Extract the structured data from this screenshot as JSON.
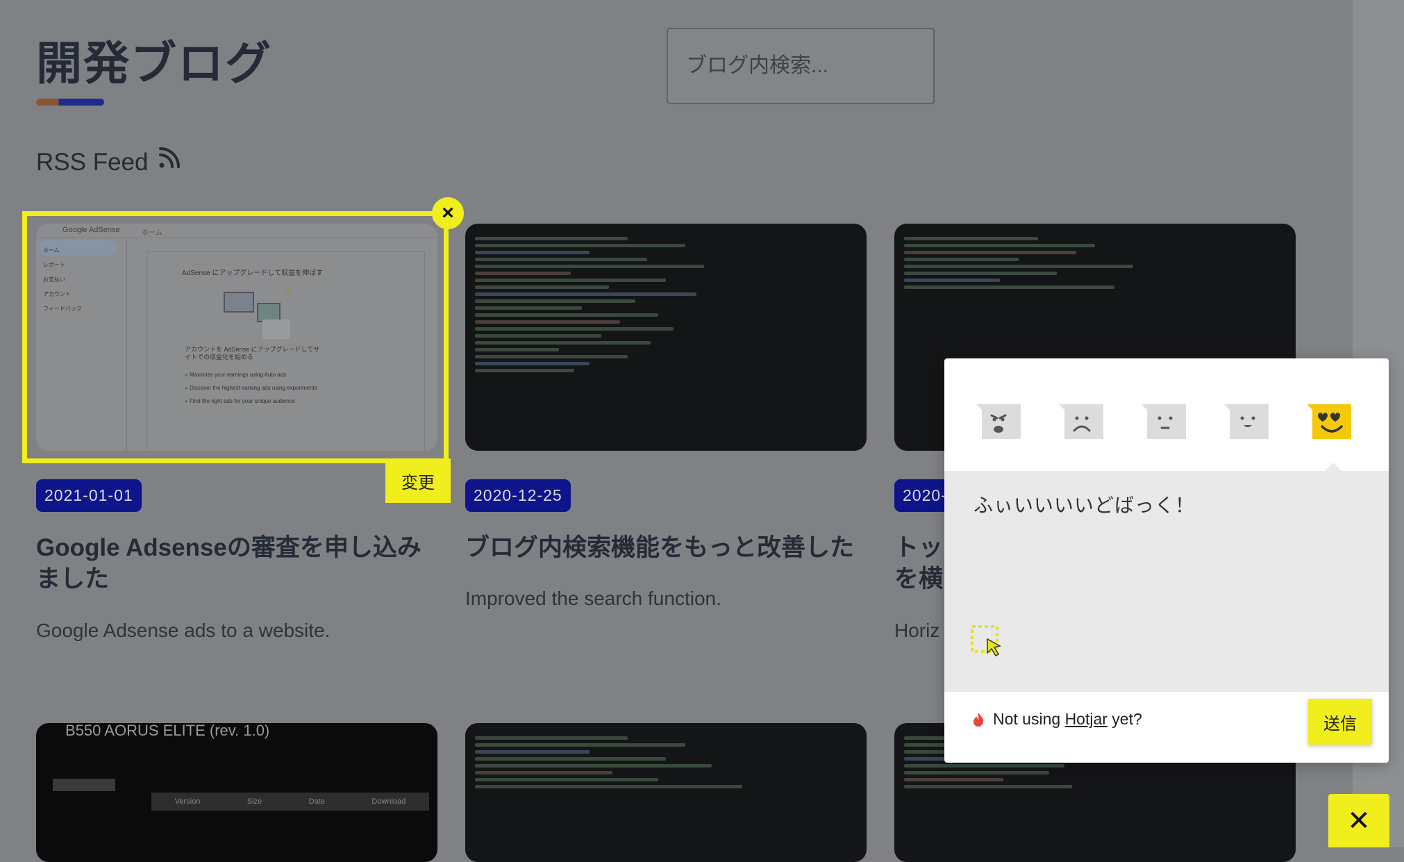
{
  "page": {
    "title": "開発ブログ",
    "search_placeholder": "ブログ内検索...",
    "rss_label": "RSS Feed"
  },
  "cards": [
    {
      "date": "2021-01-01",
      "title": "Google Adsenseの審査を申し込みました",
      "description": "Google Adsense ads to a website."
    },
    {
      "date": "2020-12-25",
      "title": "ブログ内検索機能をもっと改善した",
      "description": "Improved the search function."
    },
    {
      "date": "2020-",
      "title": "トッ を横",
      "description": "Horiz"
    }
  ],
  "adsense_thumb": {
    "brand": "Google AdSense",
    "home": "ホーム",
    "heading": "AdSense にアップグレードして収益を伸ばす",
    "body": "アカウントを AdSense にアップグレードしてサイトでの収益化を始める",
    "items": [
      "Maximize your earnings using Auto ads",
      "Discover the highest earning ads using experiments",
      "Find the right ads for your unique audience"
    ],
    "nav": [
      "ホーム",
      "レポート",
      "お支払い",
      "アカウント",
      "フィードバック"
    ]
  },
  "bottom_thumb": {
    "heading": "B550 AORUS ELITE (rev. 1.0)",
    "cols": [
      "Version",
      "Size",
      "Date",
      "Download"
    ]
  },
  "overlay": {
    "close_symbol": "×",
    "change_label": "変更",
    "close_big": "✕"
  },
  "popup": {
    "feedback_text": "ふぃいいいいどばっく！",
    "footer_prefix": "Not using ",
    "footer_link": "Hotjar",
    "footer_suffix": " yet?",
    "send_label": "送信",
    "selected_mood": "love"
  },
  "colors": {
    "accent_yellow": "#f0ee1c",
    "date_badge": "#0e158a"
  }
}
